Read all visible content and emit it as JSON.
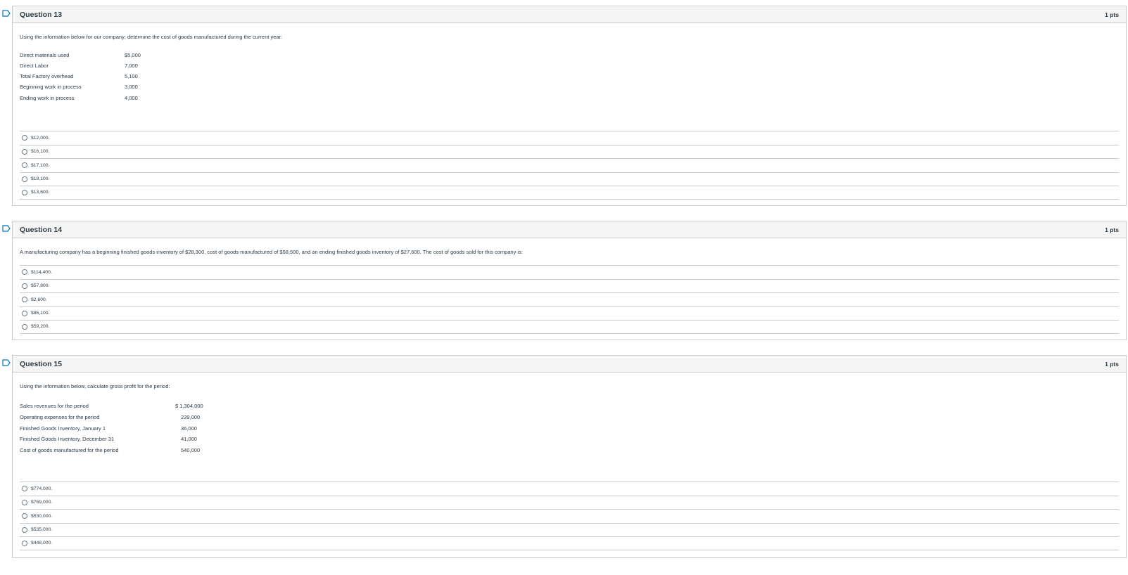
{
  "colors": {
    "border": "#c7cdd1",
    "header_bg": "#f5f5f5",
    "flag": "#0374b5",
    "text": "#2d3b45"
  },
  "questions": [
    {
      "title": "Question 13",
      "points": "1 pts",
      "text": "Using the information below for our company; determine the cost of goods manufactured during the current year:",
      "rows": [
        {
          "label": "Direct materials used",
          "value": "$5,000"
        },
        {
          "label": "Direct Labor",
          "value": "7,000"
        },
        {
          "label": "Total Factory overhead",
          "value": "5,100"
        },
        {
          "label": "Beginning work in process",
          "value": "3,000"
        },
        {
          "label": "Ending work in process",
          "value": "4,000"
        }
      ],
      "answers": [
        "$12,000.",
        "$16,100.",
        "$17,100.",
        "$18,100.",
        "$13,600."
      ]
    },
    {
      "title": "Question 14",
      "points": "1 pts",
      "text": "A manufacturing company has a beginning finished goods inventory of $28,300, cost of goods manufactured of $58,500, and an ending finished goods inventory of $27,600. The cost of goods sold for this company is:",
      "rows": [],
      "answers": [
        "$114,400.",
        "$57,800.",
        "$2,600.",
        "$86,100.",
        "$59,200."
      ]
    },
    {
      "title": "Question 15",
      "points": "1 pts",
      "text": "Using the information below, calculate gross profit for the period:",
      "rows": [
        {
          "label": "Sales revenues for the period",
          "value": "$ 1,304,000"
        },
        {
          "label": "Operating expenses for the period",
          "value": "239,000"
        },
        {
          "label": "Finished Goods Inventory, January 1",
          "value": "36,000"
        },
        {
          "label": "Finished Goods Inventory, December 31",
          "value": "41,000"
        },
        {
          "label": "Cost of goods manufactured for the period",
          "value": "540,000"
        }
      ],
      "answers": [
        "$774,000.",
        "$769,000.",
        "$530,000.",
        "$535,000.",
        "$448,000."
      ]
    }
  ]
}
